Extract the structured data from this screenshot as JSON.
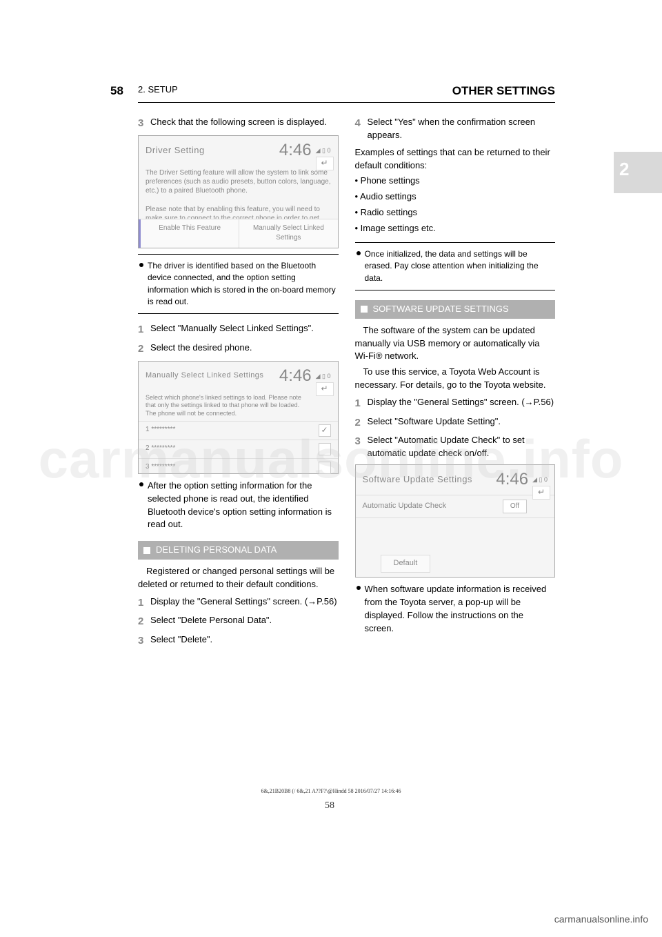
{
  "page": {
    "number_top": "58",
    "section_tab": "2. SETUP",
    "chapter_title": "OTHER SETTINGS",
    "bottom_number": "58",
    "legal": "6&,21B20B8  (/  6&,21 A??F?\\@Hindd   58 2016/07/27   14:16:46",
    "side_tab": "2"
  },
  "left": {
    "step3_num": "3",
    "step3_text": "Check that the following screen is displayed.",
    "scr1": {
      "title": "Driver Setting",
      "time": "4:46",
      "back": "↵",
      "p1": "The Driver Setting feature will allow the system to link some preferences (such as audio presets, button colors, language, etc.) to a paired Bluetooth phone.",
      "p2": "Please note that by enabling this feature, you will need to make sure to connect to the correct phone in order to get your settings.",
      "btn_enable": "Enable This Feature",
      "btn_manual": "Manually Select Linked Settings"
    },
    "hint": "The driver is identified based on the Bluetooth device connected, and the option setting information which is stored in the on-board memory is read out.",
    "m_step1_num": "1",
    "m_step1_text": "Select \"Manually Select Linked Settings\".",
    "m_step2_num": "2",
    "m_step2_text": "Select the desired phone.",
    "scr2": {
      "title": "Manually Select Linked Settings",
      "time": "4:46",
      "back": "↵",
      "desc": "Select which phone's linked settings to load. Please note that only the settings linked to that phone will be loaded. The phone will not be connected.",
      "r1": "1   *********",
      "r2": "2   *********",
      "r3": "3   *********",
      "checked": "✓"
    },
    "bullet_after": "After the option setting information for the selected phone is read out, the identified Bluetooth device's option setting information is read out.",
    "blackbox": "DELETING PERSONAL DATA",
    "del_intro": "Registered or changed personal settings will be deleted or returned to their default conditions.",
    "d1_num": "1",
    "d1_text": "Display the \"General Settings\" screen. (→P.56)",
    "d2_num": "2",
    "d2_text": "Select \"Delete Personal Data\".",
    "d3_num": "3",
    "d3_text": "Select \"Delete\"."
  },
  "right": {
    "r4_num": "4",
    "r4_text": "Select \"Yes\" when the confirmation screen appears.",
    "examples_intro": "Examples of settings that can be returned to their default conditions:",
    "ex1": "• Phone settings",
    "ex2": "• Audio settings",
    "ex3": "• Radio settings",
    "ex4": "• Image settings etc.",
    "hint_r": "Once initialized, the data and settings will be erased. Pay close attention when initializing the data.",
    "blackbox_r": "SOFTWARE UPDATE SETTINGS",
    "sw_intro1": "The software of the system can be updated manually via USB memory or automatically via Wi-Fi® network.",
    "sw_intro2": "To use this service, a Toyota Web Account is necessary. For details, go to the Toyota website.",
    "s1_num": "1",
    "s1_text": "Display the \"General Settings\" screen. (→P.56)",
    "s2_num": "2",
    "s2_text": "Select \"Software Update Setting\".",
    "s3_num": "3",
    "s3_text": "Select \"Automatic Update Check\" to set automatic update check on/off.",
    "scr3": {
      "title": "Software Update Settings",
      "time": "4:46",
      "back": "↵",
      "row_label": "Automatic Update Check",
      "row_off": "Off",
      "default_btn": "Default"
    },
    "bullet_r": "When software update information is received from the Toyota server, a pop-up will be displayed. Follow the instructions on the screen."
  },
  "watermark": "carmanualsonline.info",
  "footer_url": "carmanualsonline.info"
}
